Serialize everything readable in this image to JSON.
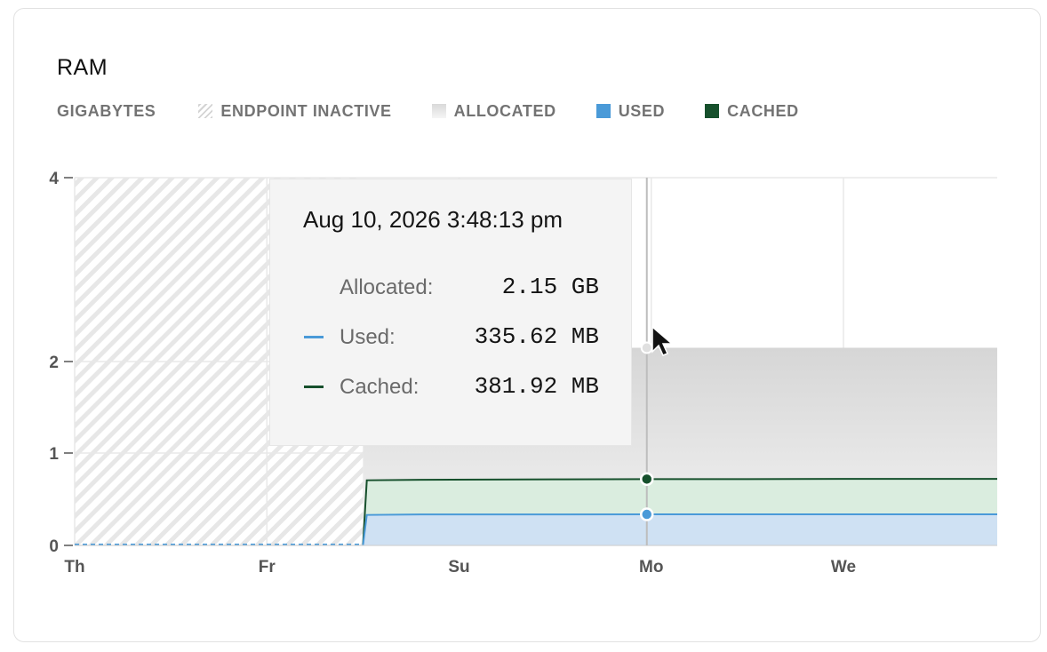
{
  "card": {
    "title": "RAM"
  },
  "legend": {
    "units": "GIGABYTES",
    "items": [
      {
        "label": "ENDPOINT INACTIVE",
        "swatch": "hatched-gray"
      },
      {
        "label": "ALLOCATED",
        "swatch": "gray-gradient"
      },
      {
        "label": "USED",
        "swatch": "#4a9ad8"
      },
      {
        "label": "CACHED",
        "swatch": "#16502c"
      }
    ]
  },
  "colors": {
    "used_line": "#4a9ad8",
    "used_fill": "#cfe1f3",
    "cached_line": "#16502c",
    "cached_fill": "#daeddf",
    "allocated_fill": "#e4e4e4",
    "grid": "#e8e8e8"
  },
  "tooltip": {
    "time": "Aug 10, 2026 3:48:13 pm",
    "rows": [
      {
        "label": "Allocated:",
        "value": "2.15 GB",
        "color": ""
      },
      {
        "label": "Used:",
        "value": "335.62 MB",
        "color": "#4a9ad8"
      },
      {
        "label": "Cached:",
        "value": "381.92 MB",
        "color": "#16502c"
      }
    ]
  },
  "chart_data": {
    "type": "area",
    "y_scale": "piecewise: 0-1 and 1-2 and 2-4 each spanning equal-ish bands",
    "y_ticks": [
      {
        "value": 0,
        "label": "0"
      },
      {
        "value": 1,
        "label": "1"
      },
      {
        "value": 2,
        "label": "2"
      },
      {
        "value": 4,
        "label": "4"
      }
    ],
    "x_ticks": [
      {
        "value": 0,
        "label": "Th"
      },
      {
        "value": 1,
        "label": "Fr"
      },
      {
        "value": 2,
        "label": "Su"
      },
      {
        "value": 3,
        "label": "Mo"
      },
      {
        "value": 4,
        "label": "We"
      }
    ],
    "x_range": [
      0,
      4.8
    ],
    "grid": true,
    "legend_position": "top-left",
    "inactive_period": [
      0,
      1.5
    ],
    "series": [
      {
        "name": "ALLOCATED",
        "x": [
          1.5,
          4.8
        ],
        "y": [
          2.15,
          2.15
        ]
      },
      {
        "name": "CACHED",
        "x": [
          1.5,
          1.52,
          1.8,
          2.5,
          3.0,
          3.5,
          4.0,
          4.8
        ],
        "y": [
          0,
          0.705,
          0.71,
          0.715,
          0.718,
          0.718,
          0.72,
          0.72
        ]
      },
      {
        "name": "USED",
        "x": [
          1.5,
          1.52,
          1.8,
          2.5,
          3.0,
          3.5,
          4.0,
          4.8
        ],
        "y": [
          0,
          0.33,
          0.335,
          0.335,
          0.336,
          0.336,
          0.336,
          0.336
        ]
      }
    ],
    "hover_x": 3.0
  }
}
